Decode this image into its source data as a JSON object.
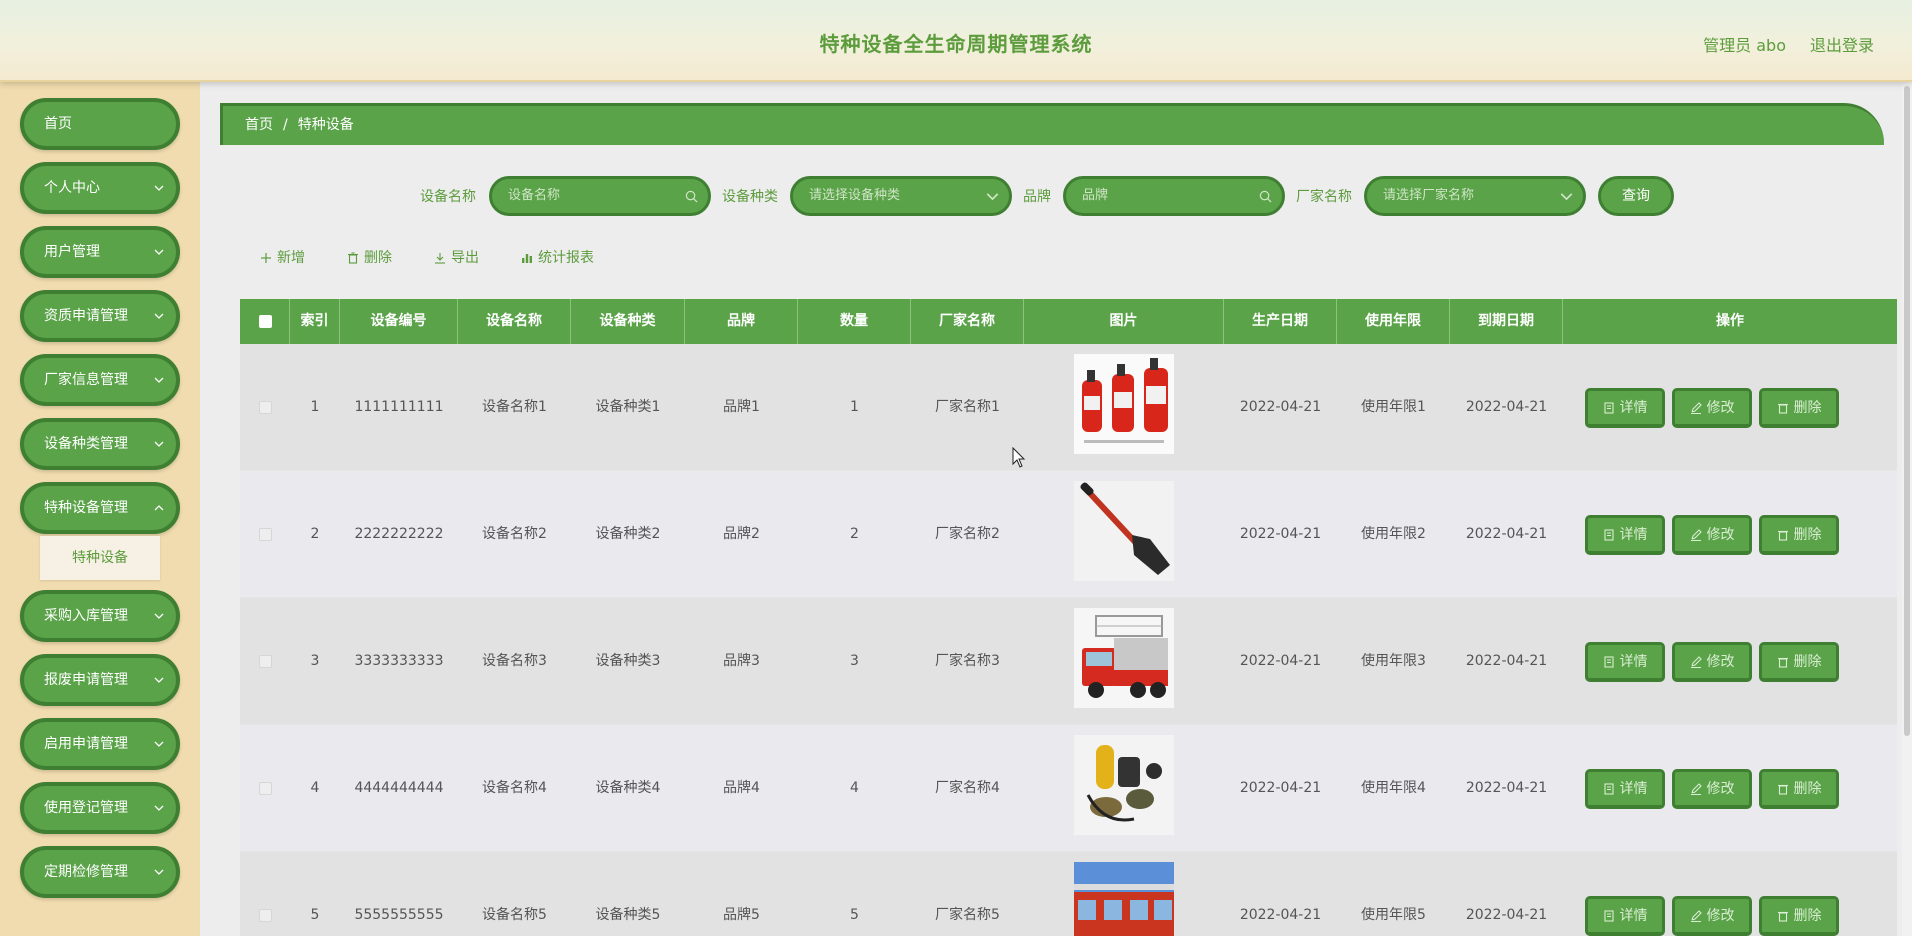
{
  "header": {
    "title": "特种设备全生命周期管理系统",
    "user": "管理员 abo",
    "logout": "退出登录"
  },
  "sidebar": {
    "items": [
      {
        "label": "首页",
        "has_children": false
      },
      {
        "label": "个人中心",
        "has_children": true
      },
      {
        "label": "用户管理",
        "has_children": true
      },
      {
        "label": "资质申请管理",
        "has_children": true
      },
      {
        "label": "厂家信息管理",
        "has_children": true
      },
      {
        "label": "设备种类管理",
        "has_children": true
      },
      {
        "label": "特种设备管理",
        "has_children": true,
        "expanded": true
      },
      {
        "label": "采购入库管理",
        "has_children": true
      },
      {
        "label": "报废申请管理",
        "has_children": true
      },
      {
        "label": "启用申请管理",
        "has_children": true
      },
      {
        "label": "使用登记管理",
        "has_children": true
      },
      {
        "label": "定期检修管理",
        "has_children": true
      }
    ],
    "submenu": {
      "label": "特种设备"
    }
  },
  "breadcrumb": {
    "home": "首页",
    "separator": "/",
    "current": "特种设备"
  },
  "search": {
    "name_label": "设备名称",
    "name_placeholder": "设备名称",
    "type_label": "设备种类",
    "type_placeholder": "请选择设备种类",
    "brand_label": "品牌",
    "brand_placeholder": "品牌",
    "maker_label": "厂家名称",
    "maker_placeholder": "请选择厂家名称",
    "query_label": "查询"
  },
  "actions": {
    "add": "新增",
    "delete": "删除",
    "export": "导出",
    "report": "统计报表"
  },
  "table": {
    "columns": [
      "索引",
      "设备编号",
      "设备名称",
      "设备种类",
      "品牌",
      "数量",
      "厂家名称",
      "图片",
      "生产日期",
      "使用年限",
      "到期日期",
      "操作"
    ],
    "rows": [
      {
        "index": "1",
        "code": "1111111111",
        "name": "设备名称1",
        "type": "设备种类1",
        "brand": "品牌1",
        "qty": "1",
        "maker": "厂家名称1",
        "image": "fire-extinguishers-image",
        "prod_date": "2022-04-21",
        "life": "使用年限1",
        "expire": "2022-04-21"
      },
      {
        "index": "2",
        "code": "2222222222",
        "name": "设备名称2",
        "type": "设备种类2",
        "brand": "品牌2",
        "qty": "2",
        "maker": "厂家名称2",
        "image": "shovel-image",
        "prod_date": "2022-04-21",
        "life": "使用年限2",
        "expire": "2022-04-21"
      },
      {
        "index": "3",
        "code": "3333333333",
        "name": "设备名称3",
        "type": "设备种类3",
        "brand": "品牌3",
        "qty": "3",
        "maker": "厂家名称3",
        "image": "fire-truck-image",
        "prod_date": "2022-04-21",
        "life": "使用年限3",
        "expire": "2022-04-21"
      },
      {
        "index": "4",
        "code": "4444444444",
        "name": "设备名称4",
        "type": "设备种类4",
        "brand": "品牌4",
        "qty": "4",
        "maker": "厂家名称4",
        "image": "breathing-apparatus-image",
        "prod_date": "2022-04-21",
        "life": "使用年限4",
        "expire": "2022-04-21"
      },
      {
        "index": "5",
        "code": "5555555555",
        "name": "设备名称5",
        "type": "设备种类5",
        "brand": "品牌5",
        "qty": "5",
        "maker": "厂家名称5",
        "image": "fire-trucks-image",
        "prod_date": "2022-04-21",
        "life": "使用年限5",
        "expire": "2022-04-21"
      }
    ],
    "row_actions": {
      "detail": "详情",
      "edit": "修改",
      "delete": "删除"
    }
  },
  "colors": {
    "primary": "#5aa349",
    "primary_dark": "#3f7f32",
    "sidebar_bg": "#f0dcae",
    "text_green": "#5d9c3d"
  }
}
